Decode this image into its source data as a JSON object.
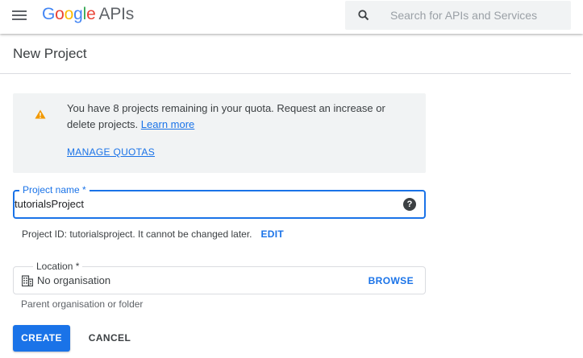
{
  "header": {
    "logo_google": "Google",
    "logo_apis": "APIs",
    "logo_colors": [
      "#4285F4",
      "#EA4335",
      "#FBBC05",
      "#4285F4",
      "#34A853",
      "#EA4335"
    ],
    "search_placeholder": "Search for APIs and Services"
  },
  "page": {
    "title": "New Project"
  },
  "notice": {
    "text": "You have 8 projects remaining in your quota. Request an increase or delete projects.",
    "learn_more": "Learn more",
    "manage_quotas": "MANAGE QUOTAS",
    "icon": "warning-icon",
    "icon_color": "#f29900"
  },
  "form": {
    "project_name_label": "Project name *",
    "project_name_value": "tutorialsProject",
    "project_id_text": "Project ID: tutorialsproject. It cannot be changed later.",
    "edit_label": "EDIT",
    "location_label": "Location *",
    "location_value": "No organisation",
    "browse_label": "BROWSE",
    "location_helper": "Parent organisation or folder"
  },
  "actions": {
    "create_label": "CREATE",
    "cancel_label": "CANCEL"
  },
  "colors": {
    "accent": "#1a73e8"
  }
}
